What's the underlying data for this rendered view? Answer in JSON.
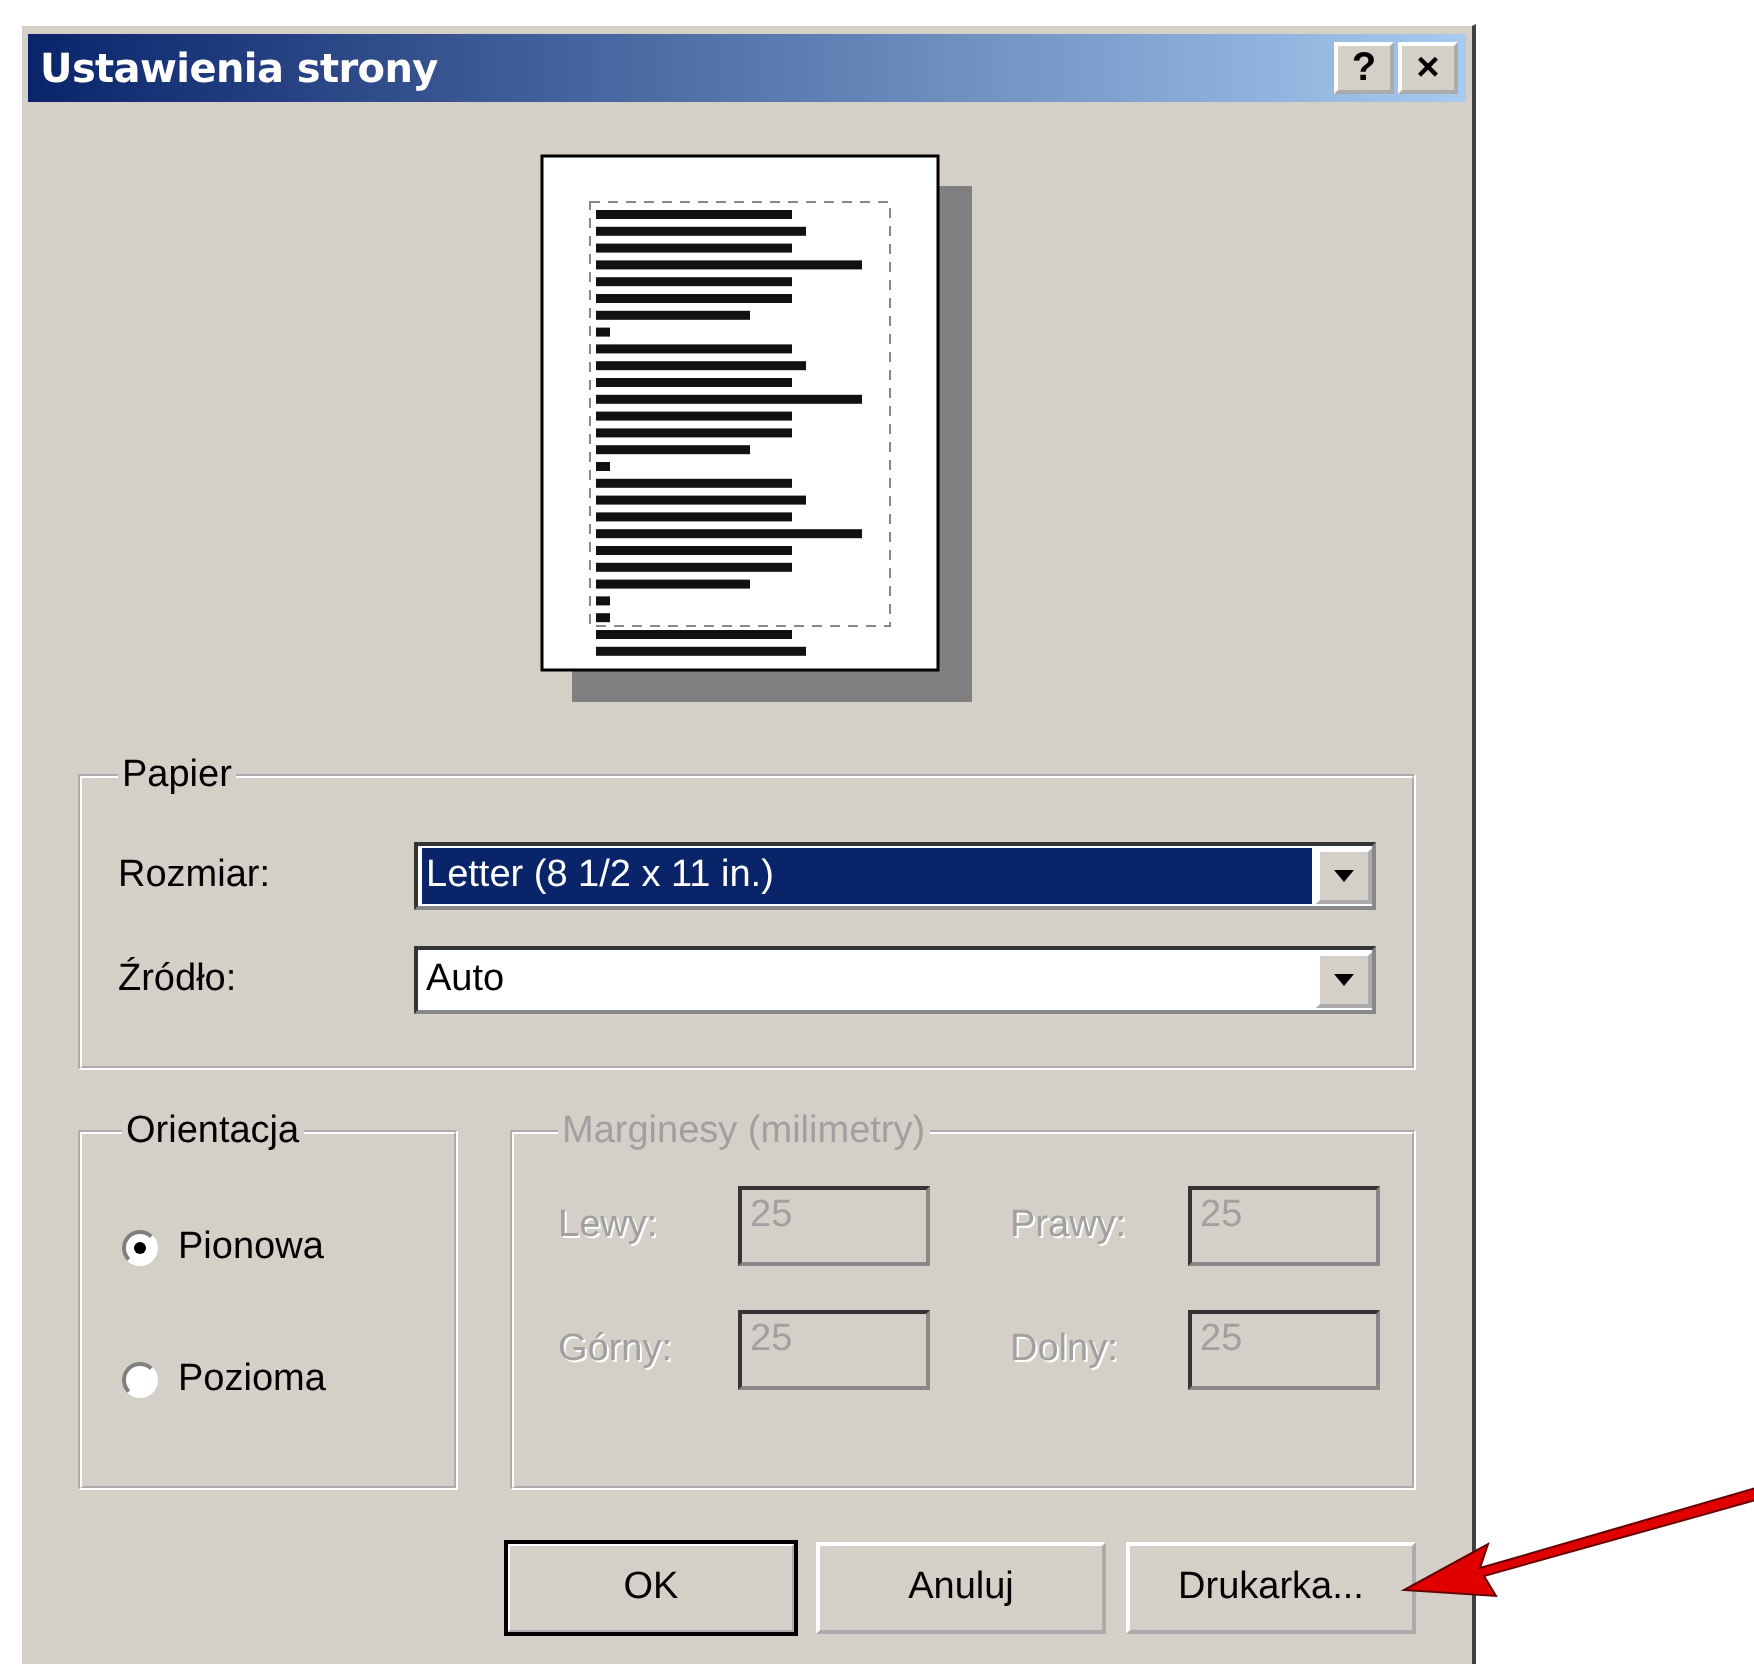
{
  "window": {
    "title": "Ustawienia strony",
    "title_buttons": [
      "?",
      "×"
    ]
  },
  "paper": {
    "legend": "Papier",
    "fields": [
      {
        "label": "Rozmiar:",
        "value": "Letter (8 1/2 x 11 in.)",
        "highlighted": true
      },
      {
        "label": "Źródło:",
        "value": "Auto",
        "highlighted": false
      }
    ]
  },
  "orientation": {
    "legend": "Orientacja",
    "options": [
      {
        "label": "Pionowa",
        "selected": true
      },
      {
        "label": "Pozioma",
        "selected": false
      }
    ]
  },
  "margins": {
    "legend": "Marginesy (milimetry)",
    "disabled": true,
    "fields": [
      {
        "label": "Lewy:",
        "value": "25"
      },
      {
        "label": "Prawy:",
        "value": "25"
      },
      {
        "label": "Górny:",
        "value": "25"
      },
      {
        "label": "Dolny:",
        "value": "25"
      }
    ]
  },
  "buttons": [
    {
      "label": "OK",
      "default": true
    },
    {
      "label": "Anuluj",
      "default": false
    },
    {
      "label": "Drukarka...",
      "default": false
    }
  ]
}
